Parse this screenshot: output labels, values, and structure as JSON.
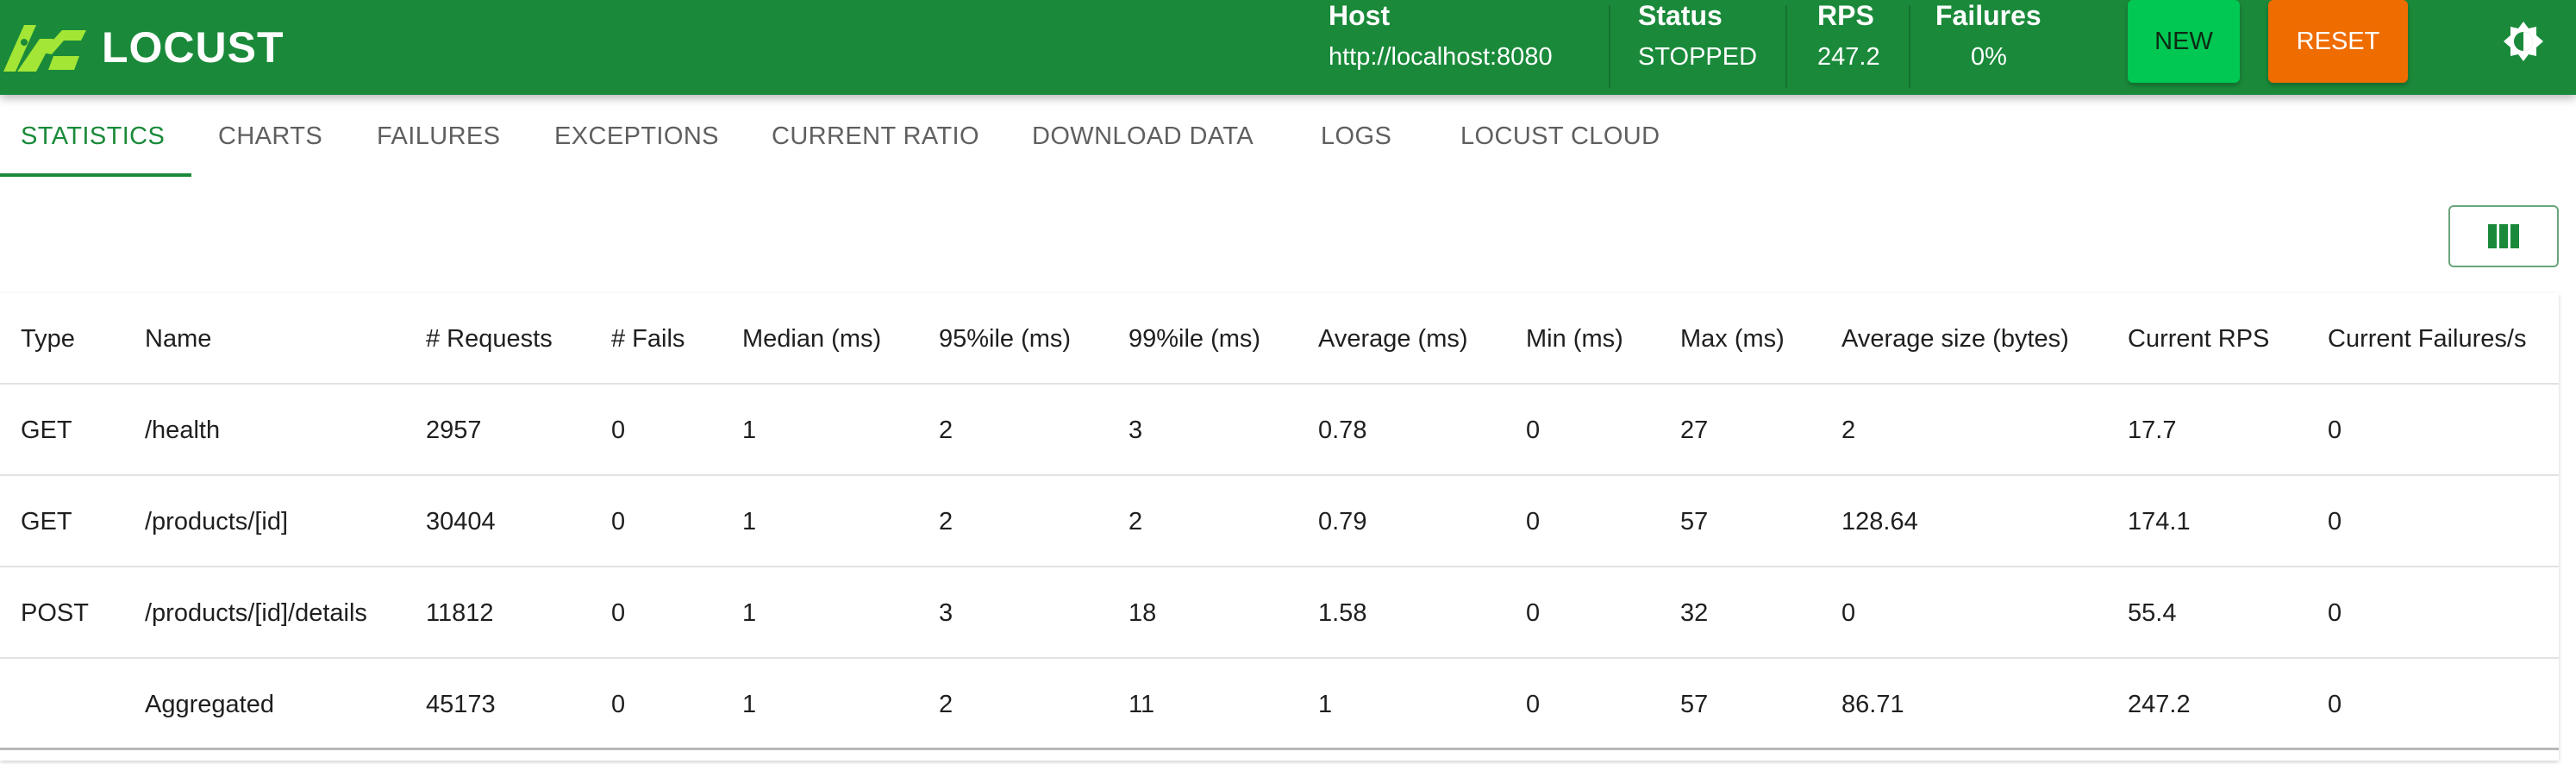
{
  "app": {
    "name": "LOCUST"
  },
  "header": {
    "host": {
      "label": "Host",
      "value": "http://localhost:8080"
    },
    "status": {
      "label": "Status",
      "value": "STOPPED"
    },
    "rps": {
      "label": "RPS",
      "value": "247.2"
    },
    "failures": {
      "label": "Failures",
      "value": "0%"
    },
    "new_label": "NEW",
    "reset_label": "RESET",
    "theme_icon": "theme-toggle-icon"
  },
  "tabs": [
    {
      "label": "STATISTICS",
      "active": true
    },
    {
      "label": "CHARTS"
    },
    {
      "label": "FAILURES"
    },
    {
      "label": "EXCEPTIONS"
    },
    {
      "label": "CURRENT RATIO"
    },
    {
      "label": "DOWNLOAD DATA"
    },
    {
      "label": "LOGS"
    },
    {
      "label": "LOCUST CLOUD"
    }
  ],
  "column_chooser_icon": "columns-icon",
  "table": {
    "headers": [
      "Type",
      "Name",
      "# Requests",
      "# Fails",
      "Median (ms)",
      "95%ile (ms)",
      "99%ile (ms)",
      "Average (ms)",
      "Min (ms)",
      "Max (ms)",
      "Average size (bytes)",
      "Current RPS",
      "Current Failures/s"
    ],
    "rows": [
      [
        "GET",
        "/health",
        "2957",
        "0",
        "1",
        "2",
        "3",
        "0.78",
        "0",
        "27",
        "2",
        "17.7",
        "0"
      ],
      [
        "GET",
        "/products/[id]",
        "30404",
        "0",
        "1",
        "2",
        "2",
        "0.79",
        "0",
        "57",
        "128.64",
        "174.1",
        "0"
      ],
      [
        "POST",
        "/products/[id]/details",
        "11812",
        "0",
        "1",
        "3",
        "18",
        "1.58",
        "0",
        "32",
        "0",
        "55.4",
        "0"
      ],
      [
        "",
        "Aggregated",
        "45173",
        "0",
        "1",
        "2",
        "11",
        "1",
        "0",
        "57",
        "86.71",
        "247.2",
        "0"
      ]
    ]
  },
  "colors": {
    "primary": "#1a8a3a",
    "new_button": "#00c853",
    "reset_button": "#ef6c00"
  }
}
